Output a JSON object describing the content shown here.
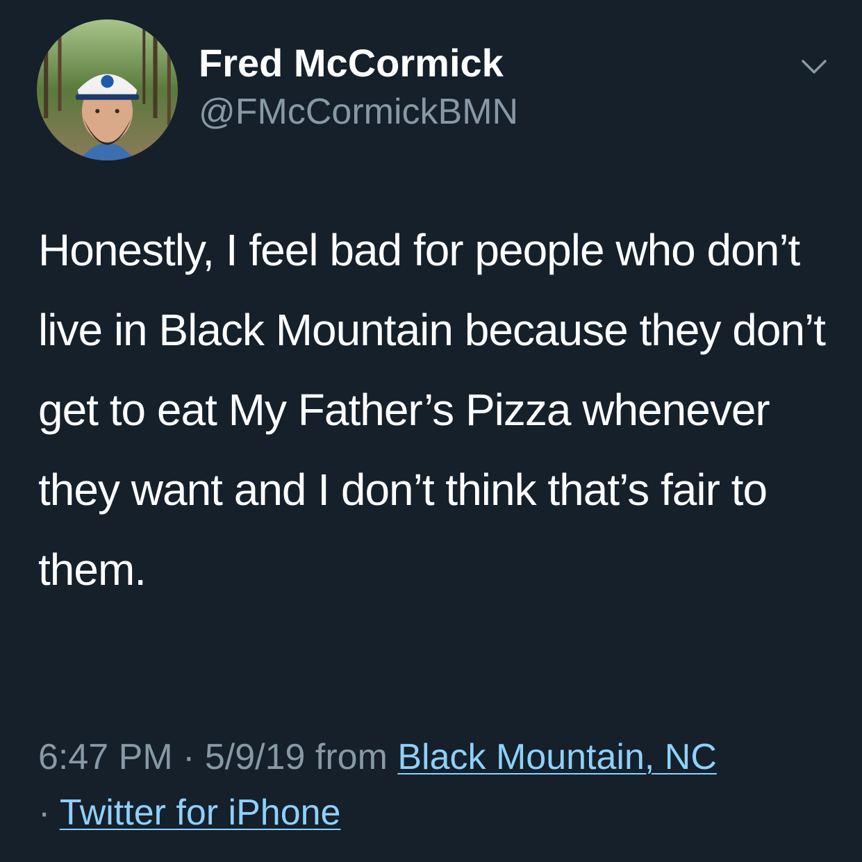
{
  "author": {
    "display_name": "Fred McCormick",
    "handle": "@FMcCormickBMN"
  },
  "tweet": {
    "text": "Honestly, I feel bad for people who don’t live in Black Mountain because they don’t get to eat My Father’s Pizza whenever they want and I don’t think that’s fair to them."
  },
  "meta": {
    "time": "6:47 PM",
    "separator": " · ",
    "date": "5/9/19",
    "from_label": " from ",
    "location": "Black Mountain, NC",
    "separator2": "· ",
    "source": "Twitter for iPhone"
  },
  "icons": {
    "menu_caret": "chevron-down-icon"
  },
  "colors": {
    "background": "#15202b",
    "text": "#ffffff",
    "secondary": "#8899a6",
    "link": "#8ed1fc"
  }
}
